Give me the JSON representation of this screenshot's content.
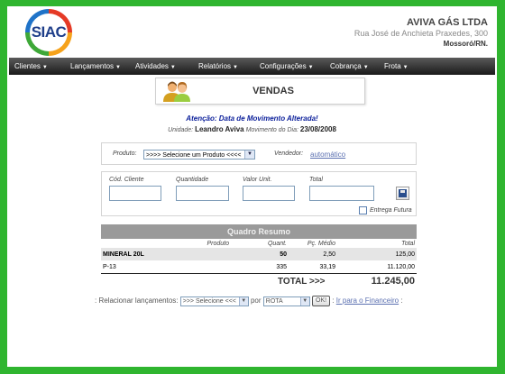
{
  "app": {
    "logo_text": "SIAC"
  },
  "company": {
    "name": "AVIVA GÁS LTDA",
    "address": "Rua José de Anchieta Praxedes, 300",
    "city": "Mossoró/RN."
  },
  "menu": [
    {
      "label": "Clientes"
    },
    {
      "label": "Lançamentos"
    },
    {
      "label": "Atividades"
    },
    {
      "label": "Relatórios"
    },
    {
      "label": "Configurações"
    },
    {
      "label": "Cobrança"
    },
    {
      "label": "Frota"
    }
  ],
  "page": {
    "title": "VENDAS"
  },
  "notice": {
    "alert": "Atenção: Data de Movimento Alterada!",
    "unit_label": "Unidade:",
    "unit_value": "Leandro Aviva",
    "date_label": "Movimento do Dia:",
    "date_value": "23/08/2008"
  },
  "form": {
    "produto_label": "Produto:",
    "produto_selected": ">>>> Selecione um Produto <<<<",
    "vendedor_label": "Vendedor:",
    "vendedor_value": "automático",
    "cod_cliente_label": "Cód. Cliente",
    "quantidade_label": "Quantidade",
    "valor_unit_label": "Valor Unit.",
    "total_label": "Total",
    "cod_cliente_value": "",
    "quantidade_value": "",
    "valor_unit_value": "",
    "total_value": "",
    "entrega_label": "Entrega Futura",
    "entrega_checked": false
  },
  "summary": {
    "title": "Quadro Resumo",
    "columns": [
      "Produto",
      "Quant.",
      "Pç. Médio",
      "Total"
    ],
    "rows": [
      {
        "produto": "MINERAL 20L",
        "quant": "50",
        "medio": "2,50",
        "total": "125,00"
      },
      {
        "produto": "P-13",
        "quant": "335",
        "medio": "33,19",
        "total": "11.120,00"
      }
    ],
    "total_label": "TOTAL >>>",
    "total_value": "11.245,00"
  },
  "bottom": {
    "prefix": ": Relacionar lançamentos:",
    "select1": ">>> Selecione <<<",
    "por": "por",
    "select2": "ROTA",
    "ok": "OK!",
    "link_prefix": ":",
    "link": "Ir para o Financeiro",
    "suffix": ":"
  }
}
